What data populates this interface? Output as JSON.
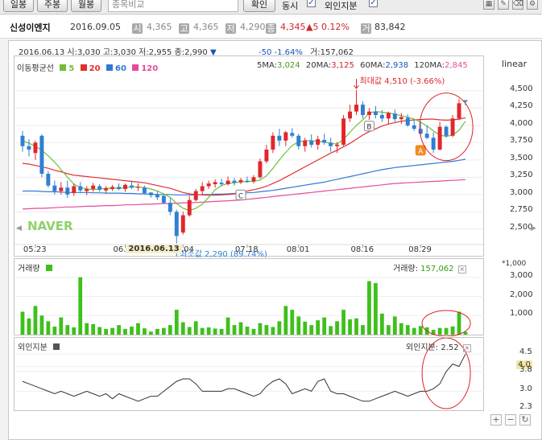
{
  "toolbar": {
    "btn_day": "일봉",
    "btn_week": "주봉",
    "btn_month": "월봉",
    "compare_placeholder": "종목비교",
    "confirm": "확인",
    "sync_label": "동시",
    "foreign_label": "외인지분"
  },
  "info": {
    "name": "신성이엔지",
    "date": "2016.09.05",
    "b1": "시",
    "v1": "4,365",
    "b2": "고",
    "v2": "4,365",
    "b3": "저",
    "v3": "4,290",
    "b4": "종",
    "v4": "4,345",
    "change": "▲5  0.12%",
    "b5": "거",
    "v5": "83,842"
  },
  "main": {
    "hover_info": "2016.06.13 시:3,030 고:3,030 저:2,955 종:2,990",
    "hover_arrow": "▼",
    "hover_change": "-50  -1.64%",
    "hover_volume": "거:157,062",
    "ma_title": "이동평균선",
    "ma5": "5",
    "ma20": "20",
    "ma60": "60",
    "ma120": "120",
    "ma5_label": "5MA:",
    "ma5_value": "3,024",
    "ma20_label": "20MA:",
    "ma20_value": "3,125",
    "ma60_label": "60MA:",
    "ma60_value": "2,938",
    "ma120_label": "120MA:",
    "ma120_value": "2,845",
    "scale": "linear",
    "max_label": "최대값 4,510 (-3.66%)",
    "min_label": "최소값 2,290 (89.74%)",
    "marker_a": "A",
    "marker_b": "B",
    "marker_c": "C",
    "watermark": "NAVER",
    "y_ticks": [
      "4,500",
      "4,250",
      "4,000",
      "3,750",
      "3,500",
      "3,250",
      "3,000",
      "2,750",
      "2,500"
    ],
    "x_ticks": [
      "05.23",
      "06.20",
      "07.04",
      "07.18",
      "08.01",
      "08.16",
      "08.29"
    ],
    "x_cursor": "2016.06.13"
  },
  "volume": {
    "title": "거래량",
    "value_label": "거래량:",
    "value": "157,062",
    "unit": "*1,000",
    "y_ticks": [
      "3,000",
      "2,000",
      "1,000"
    ]
  },
  "foreign": {
    "title": "외인지분",
    "value_label": "외인지분: 2.52",
    "y_ticks": [
      "4.5",
      "4.0",
      "3.8",
      "3.0",
      "2.3"
    ]
  },
  "colors": {
    "up": "#e2262c",
    "down": "#2f7fd3",
    "ma5": "#6fbf3a",
    "ma20": "#e22e2e",
    "ma60": "#3477d6",
    "ma120": "#e44c9b",
    "volume": "#3ec01b"
  },
  "chart_data": {
    "type": "candlestick",
    "candles": [
      {
        "o": 3850,
        "h": 3920,
        "l": 3620,
        "c": 3700
      },
      {
        "o": 3700,
        "h": 3800,
        "l": 3550,
        "c": 3650
      },
      {
        "o": 3600,
        "h": 3780,
        "l": 3500,
        "c": 3750
      },
      {
        "o": 3850,
        "h": 3870,
        "l": 3250,
        "c": 3300
      },
      {
        "o": 3300,
        "h": 3340,
        "l": 3100,
        "c": 3130
      },
      {
        "o": 3130,
        "h": 3200,
        "l": 3000,
        "c": 3050
      },
      {
        "o": 3050,
        "h": 3180,
        "l": 3000,
        "c": 3100
      },
      {
        "o": 3100,
        "h": 3200,
        "l": 2950,
        "c": 3000
      },
      {
        "o": 3020,
        "h": 3160,
        "l": 2980,
        "c": 3120
      },
      {
        "o": 3120,
        "h": 3180,
        "l": 3020,
        "c": 3060
      },
      {
        "o": 3050,
        "h": 3120,
        "l": 2990,
        "c": 3080
      },
      {
        "o": 3080,
        "h": 3170,
        "l": 3040,
        "c": 3130
      },
      {
        "o": 3120,
        "h": 3150,
        "l": 3040,
        "c": 3070
      },
      {
        "o": 3060,
        "h": 3120,
        "l": 3020,
        "c": 3090
      },
      {
        "o": 3080,
        "h": 3140,
        "l": 3050,
        "c": 3110
      },
      {
        "o": 3110,
        "h": 3160,
        "l": 3060,
        "c": 3080
      },
      {
        "o": 3080,
        "h": 3160,
        "l": 3040,
        "c": 3140
      },
      {
        "o": 3130,
        "h": 3200,
        "l": 3080,
        "c": 3100
      },
      {
        "o": 3100,
        "h": 3160,
        "l": 3050,
        "c": 3110
      },
      {
        "o": 3100,
        "h": 3130,
        "l": 3000,
        "c": 3020
      },
      {
        "o": 3030,
        "h": 3030,
        "l": 2955,
        "c": 2990
      },
      {
        "o": 3000,
        "h": 3050,
        "l": 2920,
        "c": 2960
      },
      {
        "o": 2980,
        "h": 3000,
        "l": 2860,
        "c": 2880
      },
      {
        "o": 2880,
        "h": 2950,
        "l": 2700,
        "c": 2750
      },
      {
        "o": 2750,
        "h": 2780,
        "l": 2290,
        "c": 2400
      },
      {
        "o": 2450,
        "h": 2750,
        "l": 2420,
        "c": 2700
      },
      {
        "o": 2700,
        "h": 2980,
        "l": 2680,
        "c": 2920
      },
      {
        "o": 2920,
        "h": 3080,
        "l": 2900,
        "c": 3050
      },
      {
        "o": 3050,
        "h": 3180,
        "l": 3000,
        "c": 3120
      },
      {
        "o": 3120,
        "h": 3200,
        "l": 3080,
        "c": 3160
      },
      {
        "o": 3150,
        "h": 3220,
        "l": 3100,
        "c": 3180
      },
      {
        "o": 3170,
        "h": 3230,
        "l": 3120,
        "c": 3150
      },
      {
        "o": 3150,
        "h": 3260,
        "l": 3130,
        "c": 3200
      },
      {
        "o": 3200,
        "h": 3240,
        "l": 3130,
        "c": 3170
      },
      {
        "o": 3180,
        "h": 3240,
        "l": 3150,
        "c": 3210
      },
      {
        "o": 3200,
        "h": 3260,
        "l": 3170,
        "c": 3180
      },
      {
        "o": 3190,
        "h": 3280,
        "l": 3160,
        "c": 3250
      },
      {
        "o": 3250,
        "h": 3520,
        "l": 3230,
        "c": 3480
      },
      {
        "o": 3480,
        "h": 3720,
        "l": 3450,
        "c": 3650
      },
      {
        "o": 3650,
        "h": 3900,
        "l": 3600,
        "c": 3850
      },
      {
        "o": 3850,
        "h": 3950,
        "l": 3700,
        "c": 3780
      },
      {
        "o": 3780,
        "h": 3920,
        "l": 3700,
        "c": 3900
      },
      {
        "o": 3890,
        "h": 3960,
        "l": 3820,
        "c": 3850
      },
      {
        "o": 3850,
        "h": 3880,
        "l": 3650,
        "c": 3700
      },
      {
        "o": 3700,
        "h": 3820,
        "l": 3620,
        "c": 3780
      },
      {
        "o": 3780,
        "h": 3870,
        "l": 3680,
        "c": 3720
      },
      {
        "o": 3720,
        "h": 3850,
        "l": 3650,
        "c": 3800
      },
      {
        "o": 3790,
        "h": 3880,
        "l": 3720,
        "c": 3750
      },
      {
        "o": 3750,
        "h": 3820,
        "l": 3620,
        "c": 3700
      },
      {
        "o": 3700,
        "h": 3760,
        "l": 3600,
        "c": 3720
      },
      {
        "o": 3720,
        "h": 4150,
        "l": 3700,
        "c": 4100
      },
      {
        "o": 4100,
        "h": 4300,
        "l": 4050,
        "c": 4200
      },
      {
        "o": 4200,
        "h": 4510,
        "l": 4150,
        "c": 4300
      },
      {
        "o": 4300,
        "h": 4350,
        "l": 4100,
        "c": 4150
      },
      {
        "o": 4150,
        "h": 4250,
        "l": 4080,
        "c": 4200
      },
      {
        "o": 4200,
        "h": 4280,
        "l": 4100,
        "c": 4150
      },
      {
        "o": 4150,
        "h": 4220,
        "l": 4050,
        "c": 4100
      },
      {
        "o": 4100,
        "h": 4200,
        "l": 4020,
        "c": 4180
      },
      {
        "o": 4170,
        "h": 4230,
        "l": 4050,
        "c": 4090
      },
      {
        "o": 4090,
        "h": 4180,
        "l": 4020,
        "c": 4120
      },
      {
        "o": 4110,
        "h": 4160,
        "l": 3980,
        "c": 4000
      },
      {
        "o": 4000,
        "h": 4080,
        "l": 3920,
        "c": 3950
      },
      {
        "o": 3950,
        "h": 4050,
        "l": 3850,
        "c": 3880
      },
      {
        "o": 3880,
        "h": 4000,
        "l": 3800,
        "c": 3820
      },
      {
        "o": 3820,
        "h": 3900,
        "l": 3600,
        "c": 3650
      },
      {
        "o": 3650,
        "h": 4050,
        "l": 3640,
        "c": 3980
      },
      {
        "o": 3980,
        "h": 4000,
        "l": 3820,
        "c": 3850
      },
      {
        "o": 3850,
        "h": 4150,
        "l": 3830,
        "c": 4100
      },
      {
        "o": 4100,
        "h": 4380,
        "l": 4080,
        "c": 4320
      },
      {
        "o": 4365,
        "h": 4365,
        "l": 4290,
        "c": 4345
      }
    ],
    "ma5": [
      3780,
      3740,
      3700,
      3640,
      3560,
      3470,
      3360,
      3250,
      3150,
      3100,
      3080,
      3070,
      3080,
      3090,
      3090,
      3090,
      3100,
      3110,
      3110,
      3100,
      3080,
      3050,
      3010,
      2960,
      2870,
      2800,
      2770,
      2800,
      2860,
      2960,
      3070,
      3130,
      3160,
      3170,
      3180,
      3190,
      3190,
      3210,
      3270,
      3380,
      3500,
      3610,
      3710,
      3760,
      3780,
      3780,
      3770,
      3760,
      3740,
      3730,
      3800,
      3900,
      4000,
      4080,
      4180,
      4200,
      4190,
      4180,
      4160,
      4140,
      4120,
      4090,
      4050,
      3990,
      3920,
      3860,
      3840,
      3860,
      3930,
      4060
    ],
    "ma20": [
      3450,
      3440,
      3420,
      3400,
      3380,
      3350,
      3330,
      3300,
      3280,
      3270,
      3260,
      3250,
      3240,
      3230,
      3220,
      3210,
      3200,
      3190,
      3180,
      3170,
      3150,
      3130,
      3110,
      3090,
      3060,
      3030,
      3010,
      3000,
      2995,
      2990,
      2990,
      2995,
      3000,
      3010,
      3030,
      3050,
      3070,
      3090,
      3120,
      3160,
      3200,
      3250,
      3300,
      3350,
      3400,
      3450,
      3500,
      3550,
      3600,
      3640,
      3690,
      3740,
      3800,
      3860,
      3910,
      3950,
      3990,
      4020,
      4040,
      4060,
      4070,
      4080,
      4085,
      4090,
      4090,
      4080,
      4075,
      4080,
      4090,
      4110
    ],
    "ma60": [
      3050,
      3050,
      3050,
      3045,
      3040,
      3040,
      3035,
      3030,
      3030,
      3030,
      3030,
      3025,
      3025,
      3020,
      3020,
      3020,
      3015,
      3015,
      3010,
      3010,
      3005,
      3000,
      3000,
      3000,
      2995,
      2995,
      2995,
      2995,
      3000,
      3000,
      3005,
      3005,
      3010,
      3015,
      3020,
      3025,
      3030,
      3040,
      3050,
      3060,
      3075,
      3090,
      3105,
      3120,
      3135,
      3150,
      3165,
      3180,
      3200,
      3220,
      3240,
      3260,
      3280,
      3300,
      3320,
      3340,
      3360,
      3375,
      3390,
      3400,
      3410,
      3420,
      3430,
      3440,
      3450,
      3460,
      3470,
      3480,
      3495,
      3510
    ],
    "ma120": [
      2790,
      2795,
      2800,
      2800,
      2805,
      2810,
      2815,
      2820,
      2820,
      2825,
      2830,
      2830,
      2835,
      2840,
      2840,
      2845,
      2850,
      2850,
      2855,
      2860,
      2860,
      2865,
      2870,
      2870,
      2875,
      2880,
      2880,
      2885,
      2890,
      2895,
      2900,
      2905,
      2910,
      2915,
      2920,
      2930,
      2940,
      2950,
      2960,
      2970,
      2980,
      2990,
      3000,
      3010,
      3020,
      3030,
      3040,
      3050,
      3060,
      3070,
      3080,
      3090,
      3100,
      3110,
      3120,
      3130,
      3140,
      3150,
      3160,
      3165,
      3170,
      3175,
      3180,
      3185,
      3190,
      3195,
      3200,
      3205,
      3210,
      3215
    ],
    "volume_thousands": [
      1200,
      850,
      1500,
      1000,
      700,
      420,
      900,
      500,
      380,
      3000,
      600,
      550,
      400,
      300,
      350,
      500,
      300,
      420,
      600,
      330,
      157,
      300,
      350,
      500,
      1300,
      650,
      400,
      700,
      350,
      380,
      320,
      300,
      900,
      500,
      650,
      420,
      300,
      600,
      500,
      400,
      700,
      1500,
      1300,
      950,
      680,
      500,
      750,
      900,
      450,
      700,
      1300,
      800,
      850,
      500,
      2800,
      2700,
      1100,
      500,
      950,
      600,
      500,
      350,
      450,
      380,
      250,
      350,
      350,
      430,
      1200,
      150
    ],
    "volume_ylim": [
      0,
      3200
    ],
    "foreign_ratio": [
      3.4,
      3.3,
      3.2,
      3.1,
      3.0,
      2.9,
      3.0,
      2.9,
      2.8,
      2.9,
      3.0,
      2.9,
      2.8,
      2.9,
      2.7,
      2.9,
      2.8,
      2.7,
      2.6,
      2.7,
      2.8,
      2.8,
      3.0,
      3.2,
      3.4,
      3.5,
      3.5,
      3.3,
      3.0,
      3.0,
      3.0,
      3.0,
      3.1,
      3.1,
      3.0,
      2.9,
      2.8,
      2.9,
      3.2,
      3.4,
      3.5,
      3.3,
      2.9,
      3.0,
      3.1,
      3.0,
      3.4,
      3.5,
      3.0,
      2.9,
      2.9,
      2.8,
      2.7,
      2.6,
      2.6,
      2.7,
      2.8,
      2.9,
      3.0,
      2.9,
      2.8,
      2.9,
      3.0,
      3.0,
      3.1,
      3.3,
      3.8,
      4.1,
      4.0,
      4.5
    ],
    "foreign_ylim": [
      2.3,
      4.7
    ],
    "ylim": [
      2300,
      4650
    ]
  }
}
